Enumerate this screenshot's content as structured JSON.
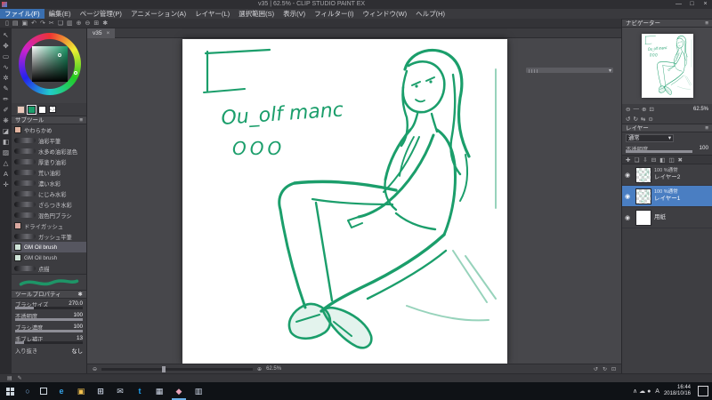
{
  "window": {
    "title": "v35 | 62.5% - CLIP STUDIO PAINT EX",
    "controls": {
      "minimize": "—",
      "maximize": "□",
      "close": "×"
    }
  },
  "menubar": {
    "items": [
      "ファイル(F)",
      "編集(E)",
      "ページ管理(P)",
      "アニメーション(A)",
      "レイヤー(L)",
      "選択範囲(S)",
      "表示(V)",
      "フィルター(I)",
      "ウィンドウ(W)",
      "ヘルプ(H)"
    ]
  },
  "command_bar": {
    "icons": [
      {
        "name": "new-file-icon",
        "glyph": "▯"
      },
      {
        "name": "open-file-icon",
        "glyph": "▤"
      },
      {
        "name": "save-icon",
        "glyph": "▣"
      },
      {
        "name": "undo-icon",
        "glyph": "↶"
      },
      {
        "name": "redo-icon",
        "glyph": "↷"
      },
      {
        "name": "cut-icon",
        "glyph": "✂"
      },
      {
        "name": "copy-icon",
        "glyph": "❏"
      },
      {
        "name": "paste-icon",
        "glyph": "▥"
      },
      {
        "name": "zoom-in-icon",
        "glyph": "⊕"
      },
      {
        "name": "zoom-out-icon",
        "glyph": "⊖"
      },
      {
        "name": "grid-icon",
        "glyph": "⊞"
      },
      {
        "name": "settings-icon",
        "glyph": "✱"
      }
    ]
  },
  "tool_strip": {
    "tools": [
      {
        "name": "operation-tool",
        "glyph": "↖"
      },
      {
        "name": "move-tool",
        "glyph": "✥"
      },
      {
        "name": "marquee-tool",
        "glyph": "▭"
      },
      {
        "name": "lasso-tool",
        "glyph": "∿"
      },
      {
        "name": "magic-wand-tool",
        "glyph": "✲"
      },
      {
        "name": "pen-tool",
        "glyph": "✎"
      },
      {
        "name": "pencil-tool",
        "glyph": "✏"
      },
      {
        "name": "brush-tool",
        "glyph": "✐"
      },
      {
        "name": "airbrush-tool",
        "glyph": "❋"
      },
      {
        "name": "eraser-tool",
        "glyph": "◪"
      },
      {
        "name": "fill-tool",
        "glyph": "◧"
      },
      {
        "name": "gradient-tool",
        "glyph": "▨"
      },
      {
        "name": "figure-tool",
        "glyph": "△"
      },
      {
        "name": "text-tool",
        "glyph": "A"
      },
      {
        "name": "eyedropper-tool",
        "glyph": "✛"
      }
    ]
  },
  "color_panel": {
    "foreground": "#1b9e6b",
    "background": "#ffffff"
  },
  "subtool": {
    "title": "サブツール",
    "selected_index": 11,
    "brushes": [
      {
        "name": "やわらかめ",
        "chip": "#e2b39f"
      },
      {
        "name": "油彩平筆"
      },
      {
        "name": "水多め油彩混色"
      },
      {
        "name": "厚塗り油彩"
      },
      {
        "name": "荒い油彩"
      },
      {
        "name": "濃い水彩"
      },
      {
        "name": "にじみ水彩"
      },
      {
        "name": "ざらつき水彩"
      },
      {
        "name": "混色円ブラシ"
      },
      {
        "name": "ドライガッシュ",
        "chip": "#d9a8a0"
      },
      {
        "name": "ガッシュ平筆"
      },
      {
        "name": "GM Oil brush",
        "chip": "#cfe3d8"
      },
      {
        "name": "GM Oil brush",
        "chip": "#cfe3d8"
      },
      {
        "name": "点描"
      }
    ]
  },
  "tool_property": {
    "title": "ツールプロパティ",
    "rows": [
      {
        "label": "ブラシサイズ",
        "value": "270.0",
        "fill": 27
      },
      {
        "label": "不透明度",
        "value": "100",
        "fill": 100
      },
      {
        "label": "ブラシ濃度",
        "value": "100",
        "fill": 100
      },
      {
        "label": "手ブレ補正",
        "value": "13",
        "fill": 13
      },
      {
        "label": "入り抜き",
        "value": "なし",
        "fill": null
      }
    ]
  },
  "canvas": {
    "tab_label": "v35",
    "tab_close": "×",
    "note_line1": "Ou_olf manc",
    "note_line2": "OOO",
    "zoom_text": "62.5%",
    "ink_color": "#1b9e6b"
  },
  "navigator": {
    "zoom_value": "62.5%",
    "zoom_icons": [
      {
        "name": "zoom-out-icon",
        "glyph": "⊖"
      },
      {
        "name": "zoom-slider",
        "glyph": "—"
      },
      {
        "name": "zoom-in-icon",
        "glyph": "⊕"
      },
      {
        "name": "fit-icon",
        "glyph": "⊡"
      }
    ],
    "rotate_icons": [
      {
        "name": "rotate-left-icon",
        "glyph": "↺"
      },
      {
        "name": "rotate-right-icon",
        "glyph": "↻"
      },
      {
        "name": "flip-horizontal-icon",
        "glyph": "⇆"
      },
      {
        "name": "reset-icon",
        "glyph": "⊙"
      }
    ]
  },
  "layers": {
    "panel_title": "レイヤー",
    "blend_mode": "通常",
    "blend_caret": "▾",
    "opacity_label": "不透明度",
    "opacity_value": "100",
    "toolbar_icons": [
      {
        "name": "new-layer-icon",
        "glyph": "✚"
      },
      {
        "name": "new-folder-icon",
        "glyph": "❏"
      },
      {
        "name": "transfer-icon",
        "glyph": "⇩"
      },
      {
        "name": "merge-icon",
        "glyph": "⊟"
      },
      {
        "name": "mask-icon",
        "glyph": "◧"
      },
      {
        "name": "lock-icon",
        "glyph": "◫"
      },
      {
        "name": "delete-layer-icon",
        "glyph": "✖"
      }
    ],
    "items": [
      {
        "mode": "100 %通常",
        "name": "レイヤー2",
        "thumb": "sketch",
        "selected": false
      },
      {
        "mode": "100 %通常",
        "name": "レイヤー1",
        "thumb": "sketch",
        "selected": true
      },
      {
        "mode": "",
        "name": "用紙",
        "thumb": "paper",
        "selected": false
      }
    ],
    "eye_glyph": "◉"
  },
  "taskbar": {
    "search_glyph": "○",
    "apps": [
      {
        "name": "edge",
        "glyph": "e",
        "color": "#35a3e8",
        "active": false
      },
      {
        "name": "explorer",
        "glyph": "▣",
        "color": "#f2c14e",
        "active": false
      },
      {
        "name": "store",
        "glyph": "⊞",
        "color": "#cfd8e8",
        "active": false
      },
      {
        "name": "mail",
        "glyph": "✉",
        "color": "#cfd8e8",
        "active": false
      },
      {
        "name": "twitter",
        "glyph": "t",
        "color": "#1da1f2",
        "active": false
      },
      {
        "name": "photos",
        "glyph": "▦",
        "color": "#cfd8e8",
        "active": false
      },
      {
        "name": "clip-studio",
        "glyph": "◆",
        "color": "#e8a2b8",
        "active": true
      },
      {
        "name": "terminal",
        "glyph": "▥",
        "color": "#cfd8e8",
        "active": false
      }
    ],
    "tray_icons": [
      {
        "name": "tray-expand-icon",
        "glyph": "∧"
      },
      {
        "name": "cloud-icon",
        "glyph": "☁"
      },
      {
        "name": "volume-icon",
        "glyph": "●"
      }
    ],
    "ime": "A",
    "time": "16:44",
    "date": "2018/10/16"
  }
}
